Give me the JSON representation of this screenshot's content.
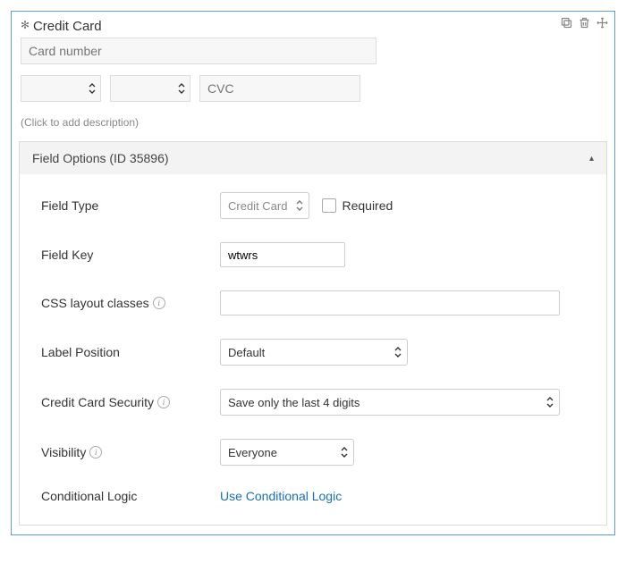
{
  "header": {
    "title": "Credit Card"
  },
  "preview": {
    "card_number_placeholder": "Card number",
    "cvc_placeholder": "CVC"
  },
  "description_placeholder": "(Click to add description)",
  "options_panel": {
    "title": "Field Options (ID 35896)",
    "rows": {
      "field_type": {
        "label": "Field Type",
        "value": "Credit Card",
        "required_label": "Required"
      },
      "field_key": {
        "label": "Field Key",
        "value": "wtwrs"
      },
      "css_classes": {
        "label": "CSS layout classes",
        "value": ""
      },
      "label_position": {
        "label": "Label Position",
        "value": "Default"
      },
      "cc_security": {
        "label": "Credit Card Security",
        "value": "Save only the last 4 digits"
      },
      "visibility": {
        "label": "Visibility",
        "value": "Everyone"
      },
      "conditional_logic": {
        "label": "Conditional Logic",
        "link": "Use Conditional Logic"
      }
    }
  }
}
